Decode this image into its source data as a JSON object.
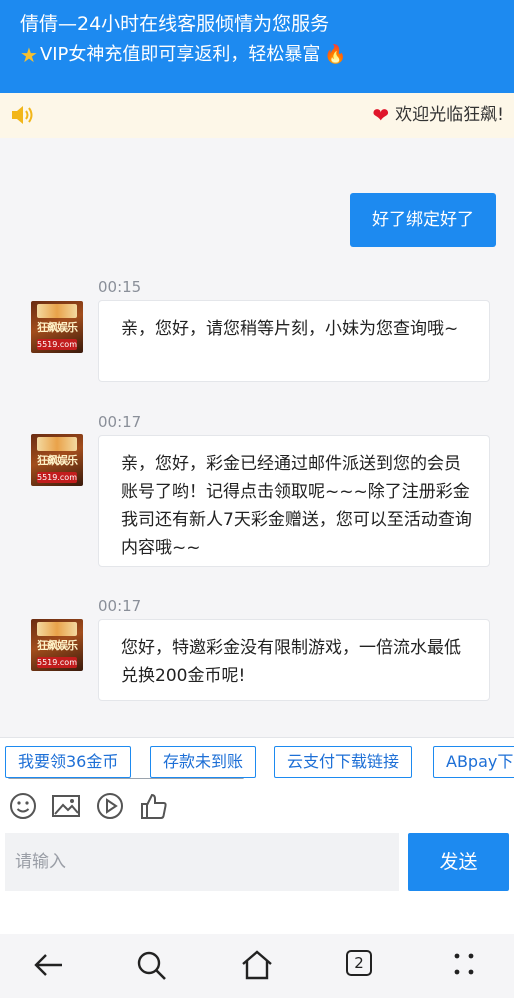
{
  "header": {
    "title": "倩倩—24小时在线客服倾情为您服务",
    "subtitle": "VIP女神充值即可享返利，轻松暴富"
  },
  "notice": {
    "text": "欢迎光临狂飙!"
  },
  "chat": {
    "sent_message": "好了绑定好了",
    "messages": [
      {
        "time": "00:15",
        "text": "亲，您好，请您稍等片刻，小妹为您查询哦~"
      },
      {
        "time": "00:17",
        "text": "亲，您好，彩金已经通过邮件派送到您的会员账号了哟！记得点击领取呢~~~除了注册彩金我司还有新人7天彩金赠送，您可以至活动查询内容哦~~"
      },
      {
        "time": "00:17",
        "text": "您好，特邀彩金没有限制游戏，一倍流水最低兑换200金币呢!"
      }
    ],
    "avatar_text": {
      "name": "狂飙娱乐",
      "site": "5519.com"
    }
  },
  "quick_replies": [
    "我要领36金币",
    "存款未到账",
    "云支付下载链接",
    "ABpay下"
  ],
  "toolbar": {
    "icons": [
      "emoji-icon",
      "image-icon",
      "play-icon",
      "thumbs-up-icon"
    ]
  },
  "input": {
    "placeholder": "请输入",
    "value": ""
  },
  "send_label": "发送",
  "nav": {
    "tab_count": "2"
  },
  "colors": {
    "accent": "#1d8af0",
    "notice_bg": "#fdf7e8",
    "heart": "#e0162b"
  }
}
